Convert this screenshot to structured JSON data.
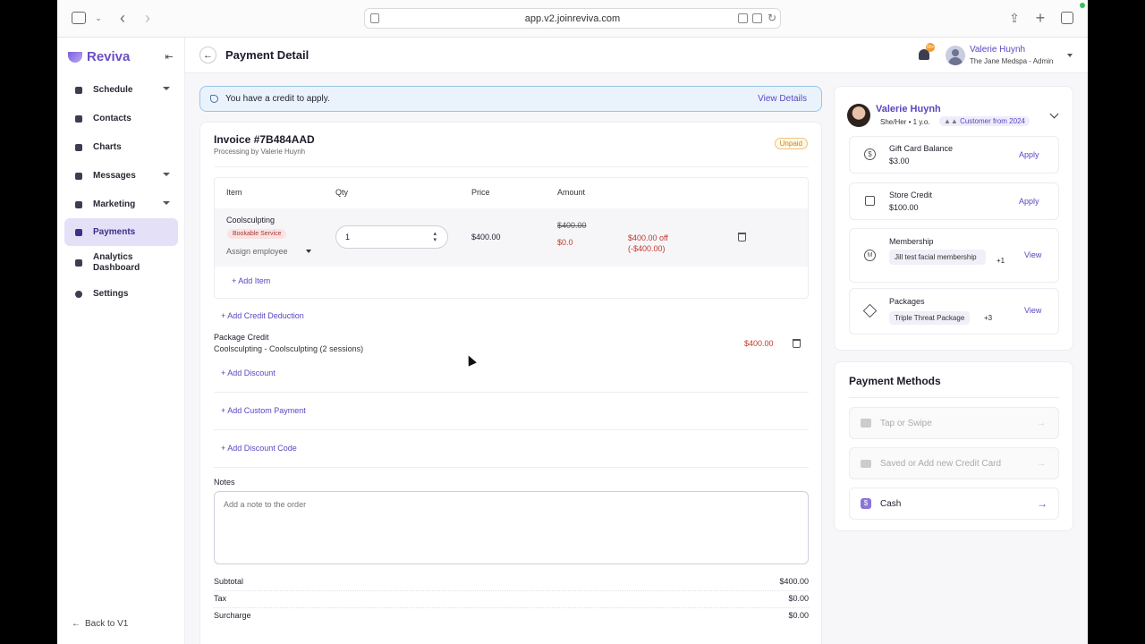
{
  "browser": {
    "url": "app.v2.joinreviva.com"
  },
  "app": {
    "brand": "Reviva"
  },
  "sidebar": {
    "items": [
      {
        "label": "Schedule"
      },
      {
        "label": "Contacts"
      },
      {
        "label": "Charts"
      },
      {
        "label": "Messages"
      },
      {
        "label": "Marketing"
      },
      {
        "label": "Payments"
      },
      {
        "label": "Analytics Dashboard"
      },
      {
        "label": "Settings"
      }
    ],
    "back_label": "Back to V1"
  },
  "header": {
    "title": "Payment Detail",
    "notification_count": "99+",
    "user_name": "Valerie Huynh",
    "user_org": "The Jane Medspa - Admin"
  },
  "credit_banner": {
    "text": "You have a credit to apply.",
    "link": "View Details"
  },
  "invoice": {
    "title": "Invoice #7B484AAD",
    "processed_by": "Processing by Valerie Huynh",
    "status": "Unpaid",
    "columns": [
      "Item",
      "Qty",
      "Price",
      "Amount"
    ],
    "line": {
      "item": "Coolsculpting",
      "tag": "Bookable Service",
      "assign": "Assign employee",
      "qty": "1",
      "price": "$400.00",
      "amount_strike": "$400.00",
      "amount": "$0.0",
      "discount": "$400.00 off (-$400.00)"
    },
    "add_item": "Add Item",
    "add_credit": "Add Credit Deduction",
    "package_title": "Package Credit",
    "package_sub": "Coolsculpting - Coolsculpting (2 sessions)",
    "package_amount": "$400.00",
    "add_discount": "Add Discount",
    "add_custom": "Add Custom Payment",
    "add_code": "Add Discount Code",
    "notes_label": "Notes",
    "notes_placeholder": "Add a note to the order",
    "totals": [
      {
        "label": "Subtotal",
        "value": "$400.00"
      },
      {
        "label": "Tax",
        "value": "$0.00"
      },
      {
        "label": "Surcharge",
        "value": "$0.00"
      }
    ]
  },
  "client": {
    "name": "Valerie Huynh",
    "meta": "She/Her • 1 y.o.",
    "since": "Customer from 2024",
    "gift_label": "Gift Card Balance",
    "gift_value": "$3.00",
    "apply": "Apply",
    "store_label": "Store Credit",
    "store_value": "$100.00",
    "membership_label": "Membership",
    "membership_chip": "Jill test facial membership",
    "membership_more": "+1",
    "view": "View",
    "packages_label": "Packages",
    "packages_chip": "Triple Threat Package",
    "packages_more": "+3"
  },
  "payment_methods": {
    "title": "Payment Methods",
    "items": [
      {
        "label": "Tap or Swipe"
      },
      {
        "label": "Saved or Add new Credit Card"
      },
      {
        "label": "Cash"
      }
    ]
  }
}
